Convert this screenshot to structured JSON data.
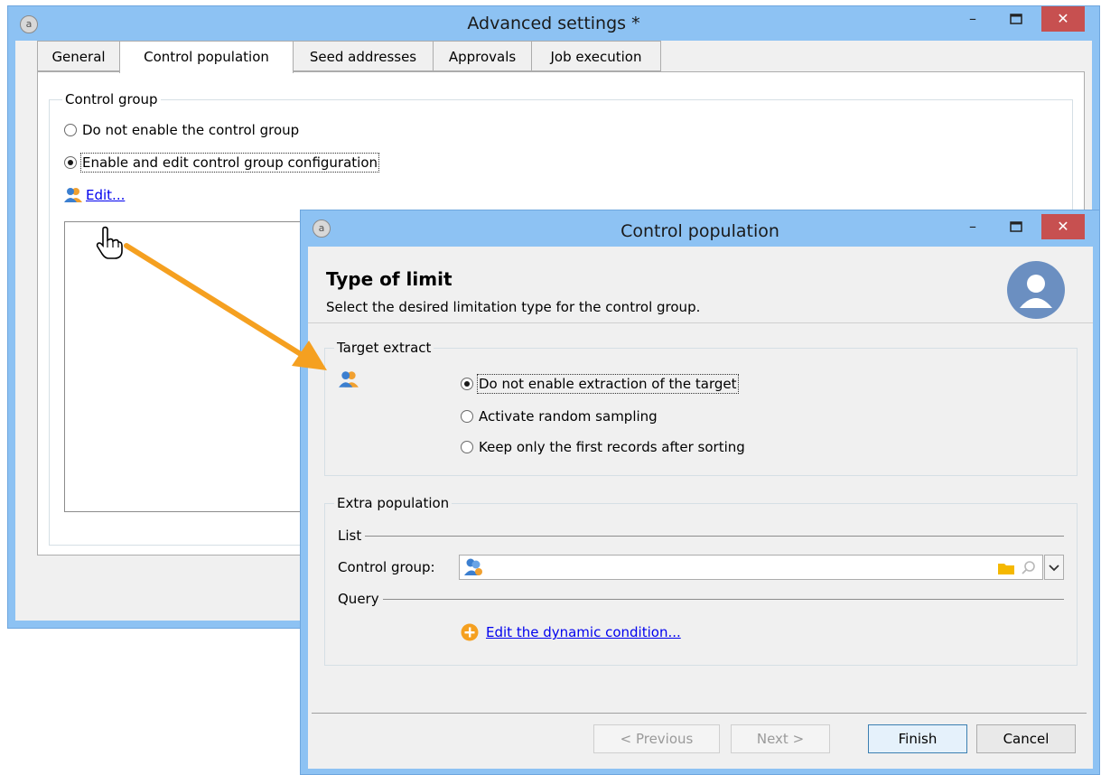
{
  "main_window": {
    "title": "Advanced settings *",
    "controls": {
      "minimize": "–",
      "maximize": "☐",
      "close": "✕"
    },
    "tabs": [
      {
        "label": "General"
      },
      {
        "label": "Control population"
      },
      {
        "label": "Seed addresses"
      },
      {
        "label": "Approvals"
      },
      {
        "label": "Job execution"
      }
    ],
    "control_group": {
      "legend": "Control group",
      "option_disable": "Do not enable the control group",
      "option_enable": "Enable and edit control group configuration",
      "edit_link": "Edit..."
    }
  },
  "dialog": {
    "title": "Control population",
    "controls": {
      "minimize": "–",
      "maximize": "☐",
      "close": "✕"
    },
    "heading": "Type of limit",
    "subheading": "Select the desired limitation type for the control group.",
    "target_extract": {
      "legend": "Target extract",
      "options": [
        "Do not enable extraction of the target",
        "Activate random sampling",
        "Keep only the first records after sorting"
      ],
      "selected_index": 0
    },
    "extra_population": {
      "legend": "Extra population",
      "list_label": "List",
      "control_group_label": "Control group:",
      "query_label": "Query",
      "dynamic_condition_link": "Edit the dynamic condition..."
    },
    "buttons": {
      "previous": "< Previous",
      "next": "Next >",
      "finish": "Finish",
      "cancel": "Cancel"
    }
  },
  "colors": {
    "title_bar": "#8dc2f3",
    "close_button": "#c75050",
    "arrow": "#f5a020",
    "link": "#0000ee",
    "avatar": "#6b8fc1"
  }
}
